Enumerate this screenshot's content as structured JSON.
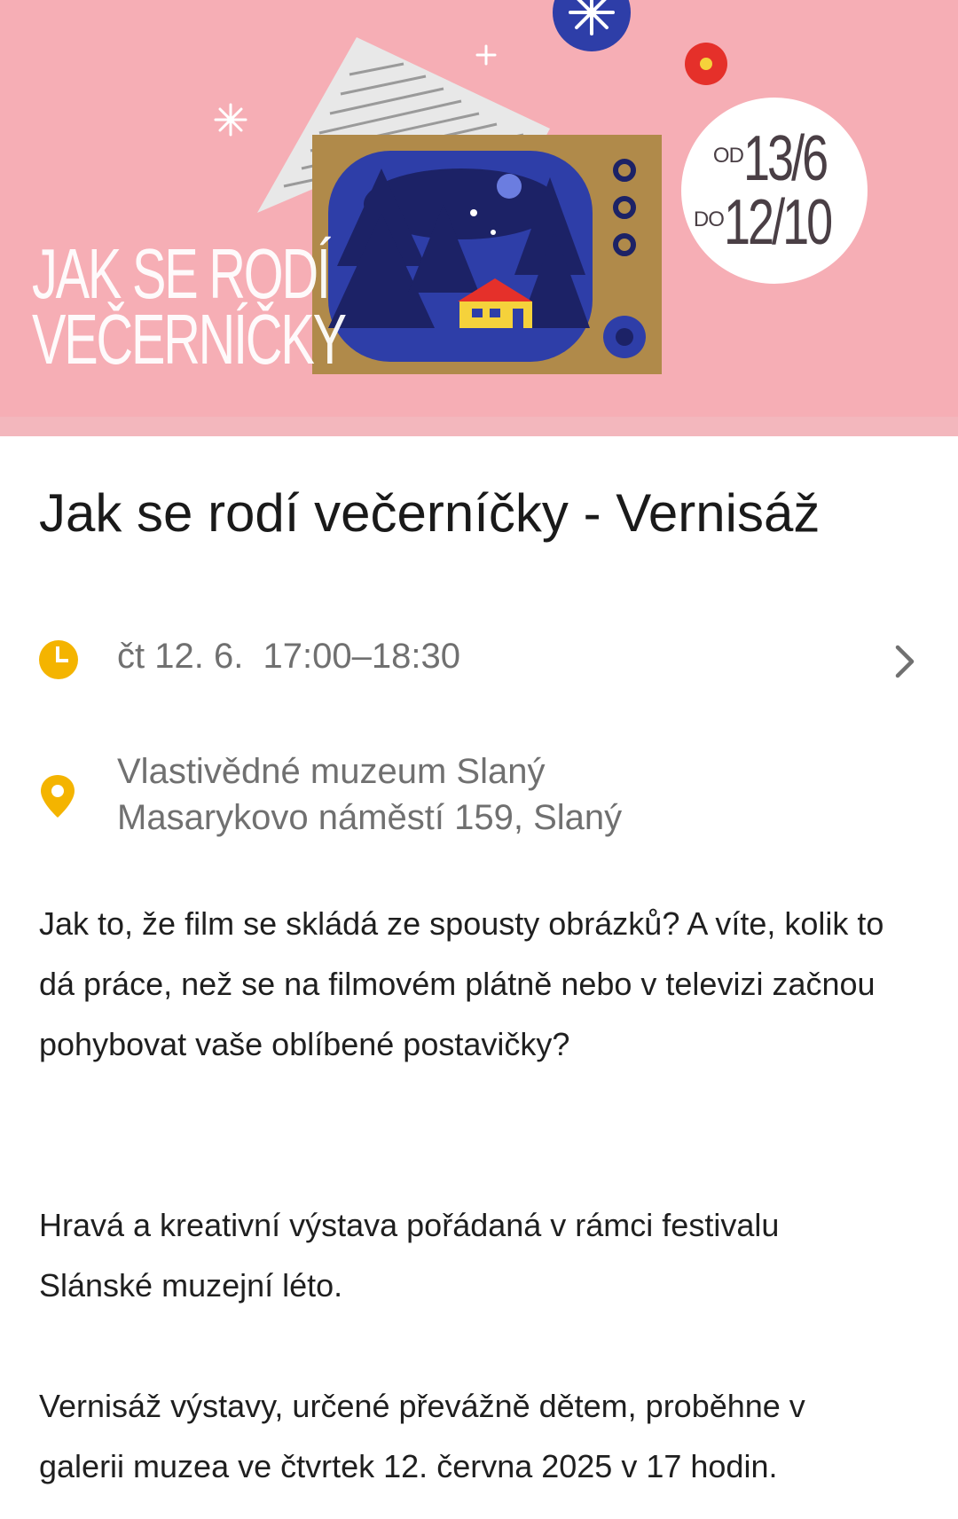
{
  "banner": {
    "title_lines": [
      "JAK SE RODÍ",
      "VEČERNÍČKY"
    ],
    "date_prefix_1": "OD",
    "date_value_1": "13/6",
    "date_prefix_2": "DO",
    "date_value_2": "12/10",
    "colors": {
      "background": "#f6aeb5",
      "tv_frame": "#b08a4a",
      "tv_screen": "#2e3ea8",
      "house": "#f5d23b"
    }
  },
  "event": {
    "title": "Jak se rodí večerníčky - Vernisáž",
    "time": "čt 12. 6.  17:00–18:30",
    "place_name": "Vlastivědné muzeum Slaný",
    "place_address": "Masarykovo náměstí 159, Slaný",
    "icons": {
      "time": "clock-icon",
      "place": "location-pin-icon",
      "more": "chevron-right-icon"
    },
    "accent_color": "#f4b400"
  },
  "description": {
    "p1": [
      "Jak to, že film se skládá ze spousty obrázků? A víte, kolik to",
      "dá práce, než se na filmovém plátně nebo v televizi začnou",
      "pohybovat vaše oblíbené postavičky?"
    ],
    "p2": [
      "Hravá a kreativní výstava pořádaná v rámci festivalu",
      "Slánské muzejní léto."
    ],
    "p3": [
      "Vernisáž výstavy, určené převážně dětem, proběhne v",
      "galerii muzea ve čtvrtek 12. června 2025 v 17 hodin."
    ]
  }
}
